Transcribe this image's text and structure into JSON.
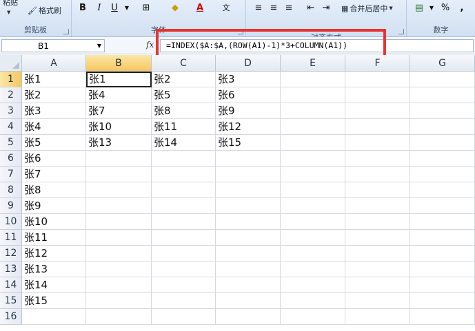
{
  "ribbon": {
    "paste_label": "粘贴",
    "format_painter_label": "格式刷",
    "clipboard_group": "剪贴板",
    "font_group": "字体",
    "alignment_group": "对齐方式",
    "merge_center_label": "合并后居中",
    "number_group": "数字",
    "percent_label": "%",
    "comma_label": ",",
    "bold_label": "B",
    "italic_label": "I",
    "underline_label": "U",
    "phonetic_label": "文"
  },
  "formula_bar": {
    "name_box": "B1",
    "fx_label": "fx",
    "formula": "=INDEX($A:$A,(ROW(A1)-1)*3+COLUMN(A1))"
  },
  "sheet": {
    "columns": [
      "A",
      "B",
      "C",
      "D",
      "E",
      "F",
      "G"
    ],
    "selected_column": "B",
    "selected_row": 1,
    "active_cell": "B1",
    "rows": [
      [
        "张1",
        "张1",
        "张2",
        "张3"
      ],
      [
        "张2",
        "张4",
        "张5",
        "张6"
      ],
      [
        "张3",
        "张7",
        "张8",
        "张9"
      ],
      [
        "张4",
        "张10",
        "张11",
        "张12"
      ],
      [
        "张5",
        "张13",
        "张14",
        "张15"
      ],
      [
        "张6"
      ],
      [
        "张7"
      ],
      [
        "张8"
      ],
      [
        "张9"
      ],
      [
        "张10"
      ],
      [
        "张11"
      ],
      [
        "张12"
      ],
      [
        "张13"
      ],
      [
        "张14"
      ],
      [
        "张15"
      ],
      []
    ]
  },
  "colors": {
    "accent_header": "#f6c75f",
    "highlight_box": "#e8342f"
  }
}
